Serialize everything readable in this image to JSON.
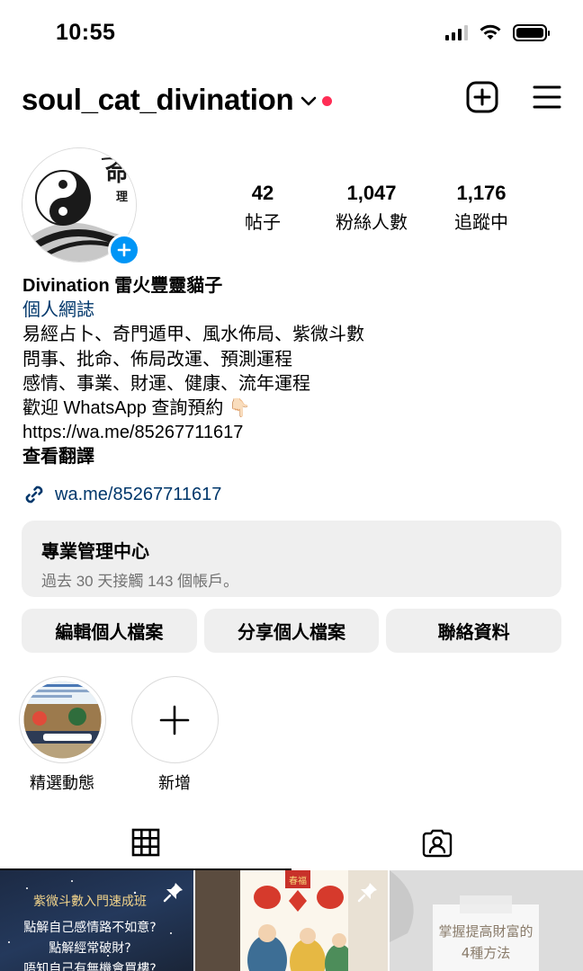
{
  "status_bar": {
    "time": "10:55"
  },
  "header": {
    "username": "soul_cat_divination"
  },
  "avatar": {
    "badge_char_1": "命",
    "badge_char_2": "理"
  },
  "stats": [
    {
      "value": "42",
      "label": "帖子"
    },
    {
      "value": "1,047",
      "label": "粉絲人數"
    },
    {
      "value": "1,176",
      "label": "追蹤中"
    }
  ],
  "bio": {
    "name": "Divination 雷火豐靈貓子",
    "category": "個人網誌",
    "lines": [
      "易經占卜、奇門遁甲、風水佈局、紫微斗數",
      "問事、批命、佈局改運、預測運程",
      "感情、事業、財運、健康、流年運程",
      "歡迎 WhatsApp 查詢預約 👇🏻",
      "https://wa.me/85267711617"
    ],
    "see_translation": "查看翻譯"
  },
  "link": {
    "text": "wa.me/85267711617"
  },
  "dashboard": {
    "title": "專業管理中心",
    "subtitle": "過去 30 天接觸 143 個帳戶。"
  },
  "buttons": {
    "edit": "編輯個人檔案",
    "share": "分享個人檔案",
    "contact": "聯絡資料"
  },
  "highlights": [
    {
      "label": "精選動態"
    },
    {
      "label": "新增"
    }
  ],
  "posts": [
    {
      "lines": [
        "紫微斗數入門速成班",
        "點解自己感情路不如意?",
        "點解經常破財?",
        "唔知自己有無機會買樓?"
      ],
      "pinned": true
    },
    {
      "lines": [
        "春福"
      ],
      "pinned": true
    },
    {
      "lines": [
        "掌握提高財富的",
        "4種方法"
      ],
      "pinned": false
    }
  ],
  "colors": {
    "accent": "#0095f6",
    "link": "#00376b",
    "notify": "#ff2d55",
    "button_bg": "#efefef"
  }
}
